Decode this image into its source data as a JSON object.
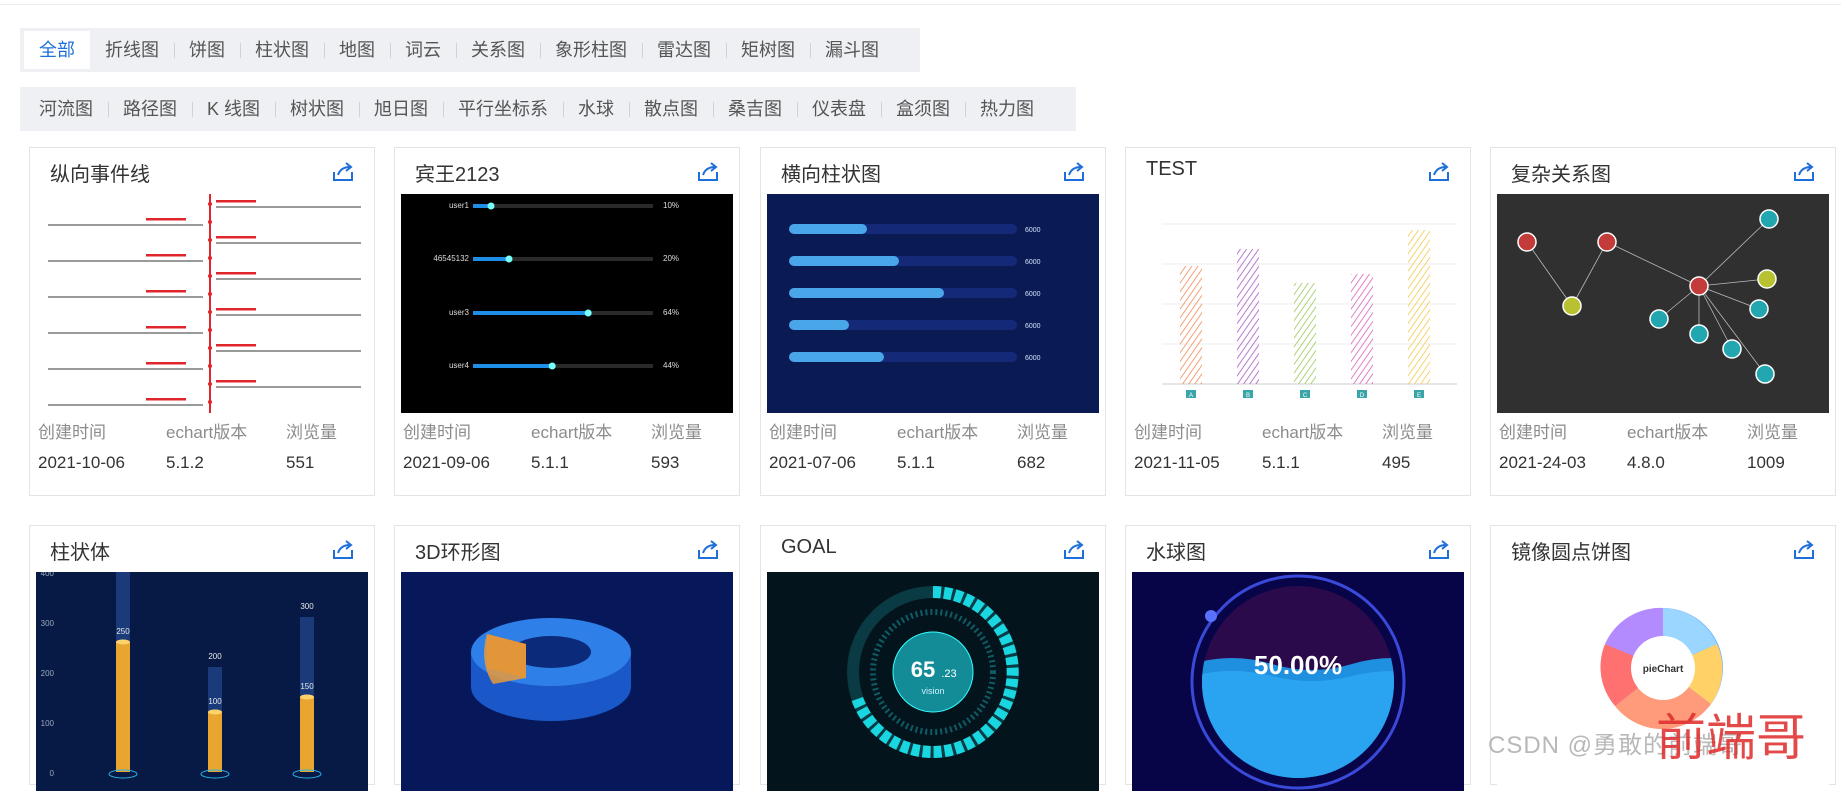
{
  "filters": {
    "row1": [
      "全部",
      "折线图",
      "饼图",
      "柱状图",
      "地图",
      "词云",
      "关系图",
      "象形柱图",
      "雷达图",
      "矩树图",
      "漏斗图"
    ],
    "row2": [
      "河流图",
      "路径图",
      "K 线图",
      "树状图",
      "旭日图",
      "平行坐标系",
      "水球",
      "散点图",
      "桑吉图",
      "仪表盘",
      "盒须图",
      "热力图"
    ],
    "active": "全部"
  },
  "meta_labels": {
    "created": "创建时间",
    "version": "echart版本",
    "views": "浏览量"
  },
  "cards_row1": [
    {
      "title": "纵向事件线",
      "created": "2021-10-06",
      "version": "5.1.2",
      "views": "551"
    },
    {
      "title": "宾王2123",
      "created": "2021-09-06",
      "version": "5.1.1",
      "views": "593"
    },
    {
      "title": "横向柱状图",
      "created": "2021-07-06",
      "version": "5.1.1",
      "views": "682"
    },
    {
      "title": "TEST",
      "created": "2021-11-05",
      "version": "5.1.1",
      "views": "495"
    },
    {
      "title": "复杂关系图",
      "created": "2021-24-03",
      "version": "4.8.0",
      "views": "1009"
    }
  ],
  "cards_row2": [
    {
      "title": "柱状体"
    },
    {
      "title": "3D环形图"
    },
    {
      "title": "GOAL"
    },
    {
      "title": "水球图"
    },
    {
      "title": "镜像圆点饼图"
    }
  ],
  "previews": {
    "bingwang_users": [
      {
        "label": "user1",
        "pct": "10%",
        "fill": 0.1
      },
      {
        "label": "46545132",
        "pct": "20%",
        "fill": 0.2
      },
      {
        "label": "user3",
        "pct": "64%",
        "fill": 0.64
      },
      {
        "label": "user4",
        "pct": "44%",
        "fill": 0.44
      }
    ],
    "hbar_value": "6000",
    "test_bar_letters": [
      "A",
      "B",
      "C",
      "D",
      "E"
    ],
    "pillar_labels": [
      "250",
      "200",
      "100",
      "300",
      "150"
    ],
    "pillar_axis": [
      "400",
      "300",
      "200",
      "100",
      "0"
    ],
    "goal_value": "65",
    "goal_decimal": ".23",
    "goal_sub": "vision",
    "liquid_value": "50.00%",
    "pie_center": "pieChart"
  },
  "watermark": "CSDN @勇敢的前端哥",
  "brand": "前端哥",
  "colors": {
    "accent": "#1e6fd9",
    "filter_bg": "#eef0f3",
    "dark_navy": "#0a1a52",
    "relation_bg": "#303030",
    "timeline_red": "#e0262b"
  }
}
